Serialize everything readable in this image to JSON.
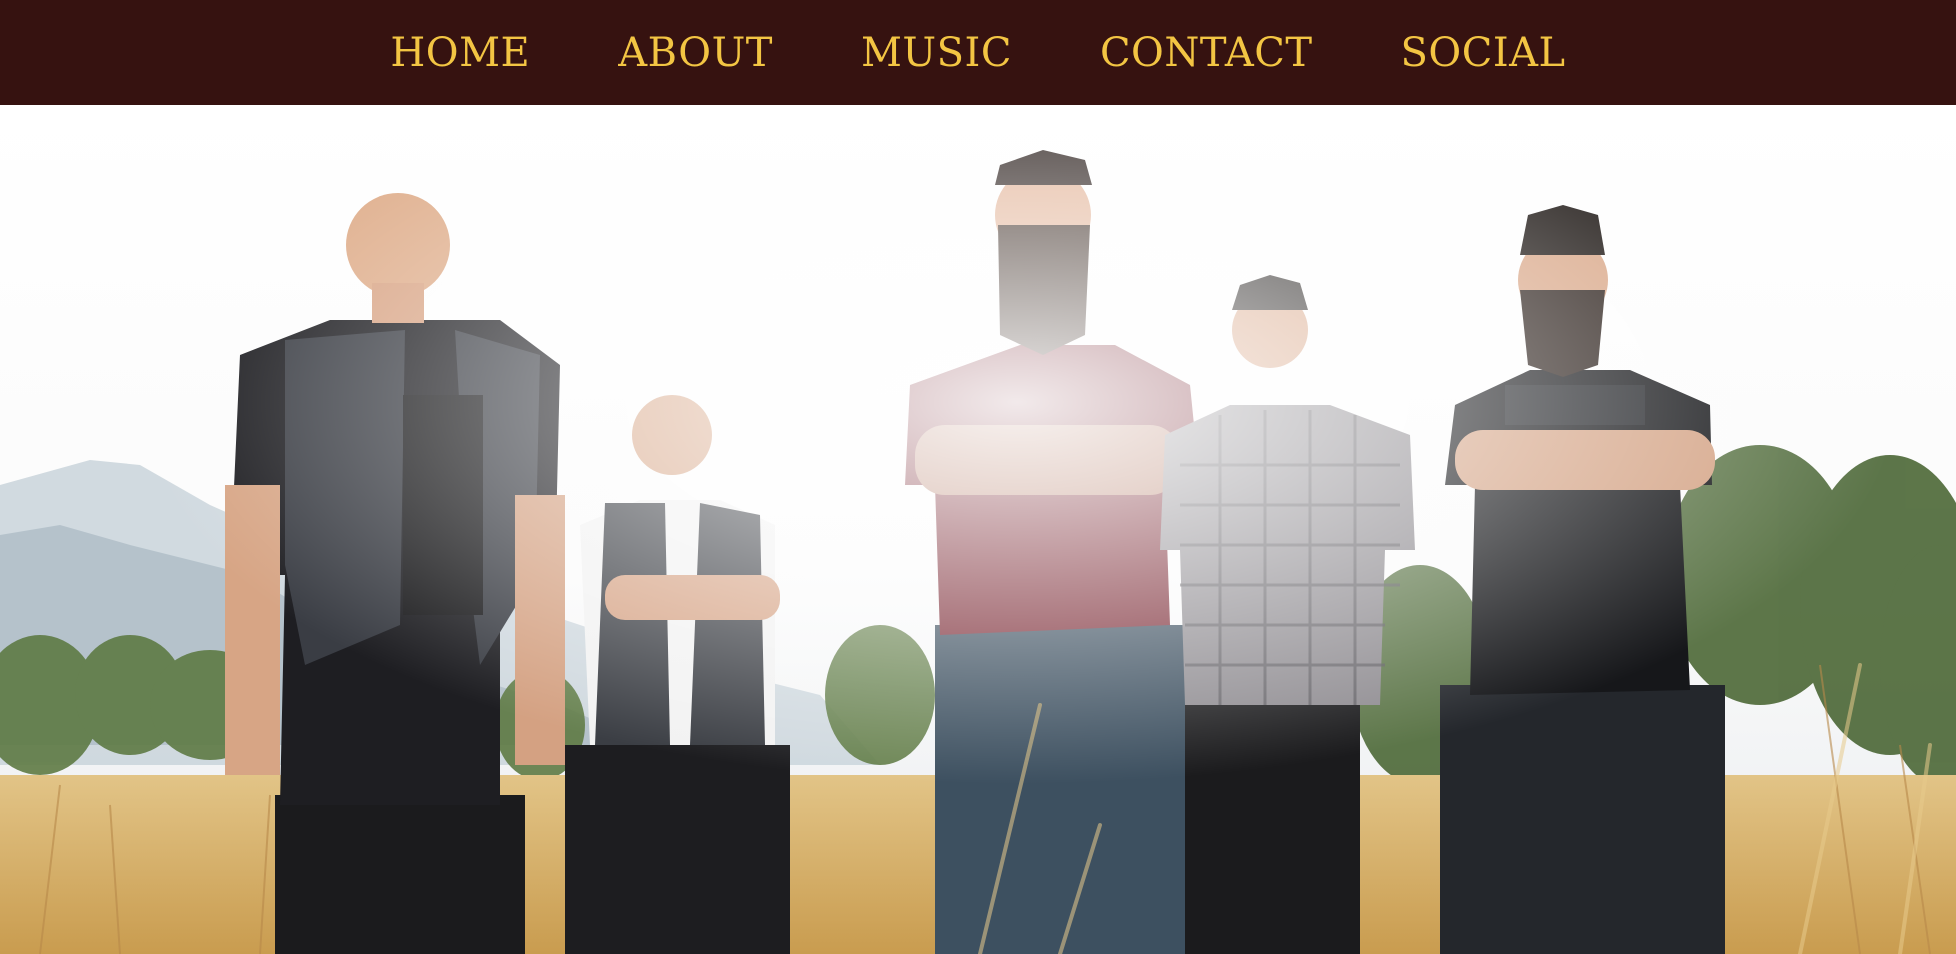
{
  "nav": {
    "items": [
      {
        "label": "HOME"
      },
      {
        "label": "ABOUT"
      },
      {
        "label": "MUSIC"
      },
      {
        "label": "CONTACT"
      },
      {
        "label": "SOCIAL"
      }
    ]
  },
  "colors": {
    "nav_bg": "#361210",
    "nav_text": "#f3c543",
    "sky": "#ffffff",
    "grass": "#d8b36a"
  },
  "hero": {
    "image_description_icon": "band-photo-image"
  }
}
